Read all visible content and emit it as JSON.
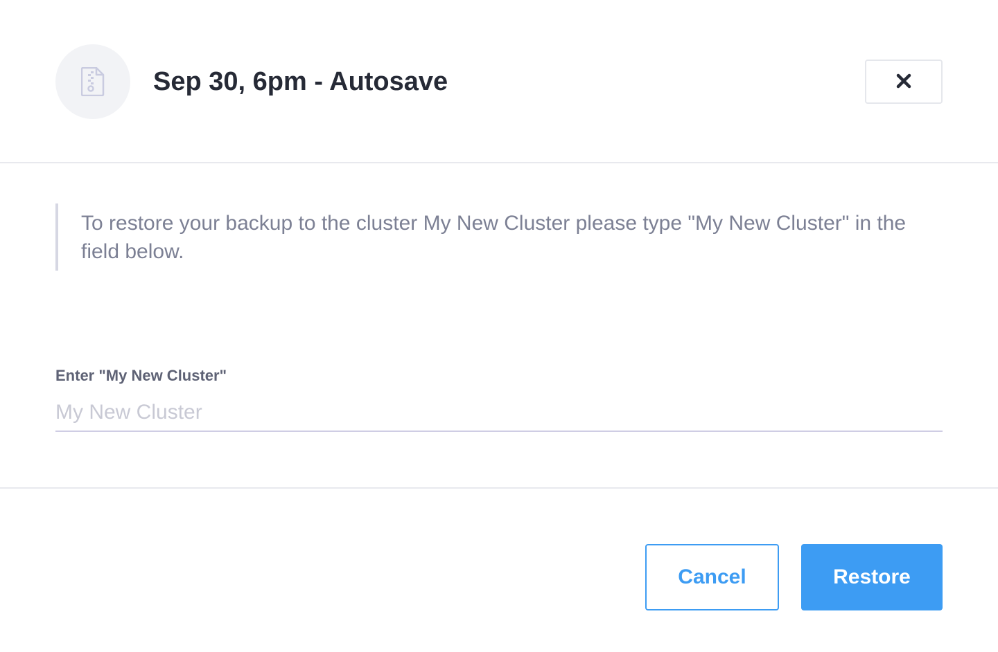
{
  "dialog": {
    "title": "Sep 30, 6pm - Autosave",
    "file_icon": "zip-file-icon",
    "close_icon": "close-icon"
  },
  "notice": {
    "text": "To restore your backup to the cluster My New Cluster please type \"My New Cluster\" in the field below."
  },
  "confirm_field": {
    "label": "Enter \"My New Cluster\"",
    "placeholder": "My New Cluster",
    "value": ""
  },
  "actions": {
    "cancel_label": "Cancel",
    "restore_label": "Restore"
  },
  "colors": {
    "accent": "#3d9cf3",
    "title": "#262a36",
    "muted_text": "#7c8094",
    "placeholder": "#c8c9d4"
  }
}
